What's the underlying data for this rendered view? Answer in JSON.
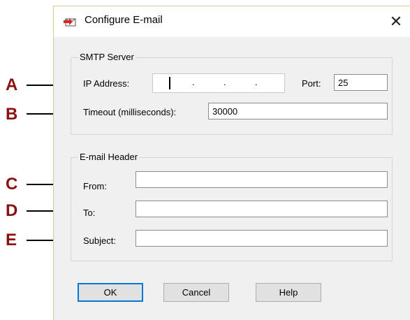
{
  "dialog": {
    "title": "Configure E-mail",
    "close_symbol": "✕"
  },
  "smtp": {
    "group_title": "SMTP Server",
    "ip_label": "IP Address:",
    "ip_dots": [
      ".",
      ".",
      "."
    ],
    "port_label": "Port:",
    "port_value": "25",
    "timeout_label": "Timeout (milliseconds):",
    "timeout_value": "30000"
  },
  "header": {
    "group_title": "E-mail Header",
    "from_label": "From:",
    "from_value": "",
    "to_label": "To:",
    "to_value": "",
    "subject_label": "Subject:",
    "subject_value": ""
  },
  "buttons": {
    "ok": "OK",
    "cancel": "Cancel",
    "help": "Help"
  },
  "callouts": [
    "A",
    "B",
    "C",
    "D",
    "E"
  ],
  "colors": {
    "callout": "#8b1111",
    "focus": "#0078d7"
  }
}
